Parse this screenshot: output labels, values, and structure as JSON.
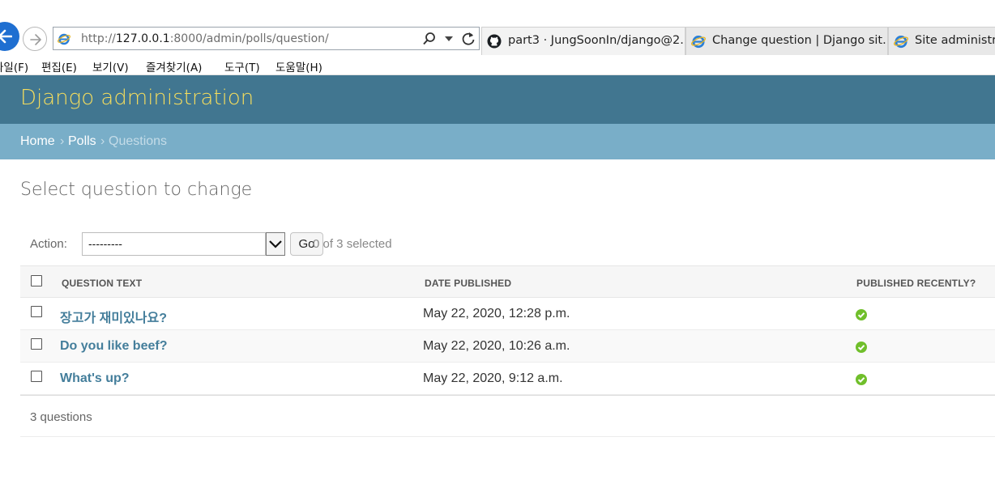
{
  "browser": {
    "url_prefix": "http://",
    "url_host": "127.0.0.1",
    "url_rest": ":8000/admin/polls/question/",
    "tabs": [
      {
        "label": "part3 · JungSoonIn/django@2..."
      },
      {
        "label": "Change question | Django sit..."
      },
      {
        "label": "Site administra"
      }
    ],
    "menu": [
      "파일(F)",
      "편집(E)",
      "보기(V)",
      "즐겨찾기(A)",
      "도구(T)",
      "도움말(H)"
    ]
  },
  "admin": {
    "site_name": "Django administration",
    "breadcrumbs": {
      "home": "Home",
      "polls": "Polls",
      "current": "Questions",
      "sep": "›"
    },
    "page_title": "Select question to change",
    "actions": {
      "label": "Action:",
      "selected_option": "---------",
      "go_label": "Go",
      "selected_count": "0 of 3 selected"
    },
    "table": {
      "headers": {
        "question_text": "QUESTION TEXT",
        "date_published": "DATE PUBLISHED",
        "published_recently": "PUBLISHED RECENTLY?"
      },
      "rows": [
        {
          "question": "장고가 재미있나요?",
          "date": "May 22, 2020, 12:28 p.m.",
          "recent": true
        },
        {
          "question": "Do you like beef?",
          "date": "May 22, 2020, 10:26 a.m.",
          "recent": true
        },
        {
          "question": "What's up?",
          "date": "May 22, 2020, 9:12 a.m.",
          "recent": true
        }
      ]
    },
    "paginator": "3 questions",
    "colors": {
      "header": "#417690",
      "breadcrumbs": "#79aec8",
      "site_name": "#f5dd5d",
      "link": "#447e9b",
      "yes_icon": "#70bf2b"
    }
  }
}
